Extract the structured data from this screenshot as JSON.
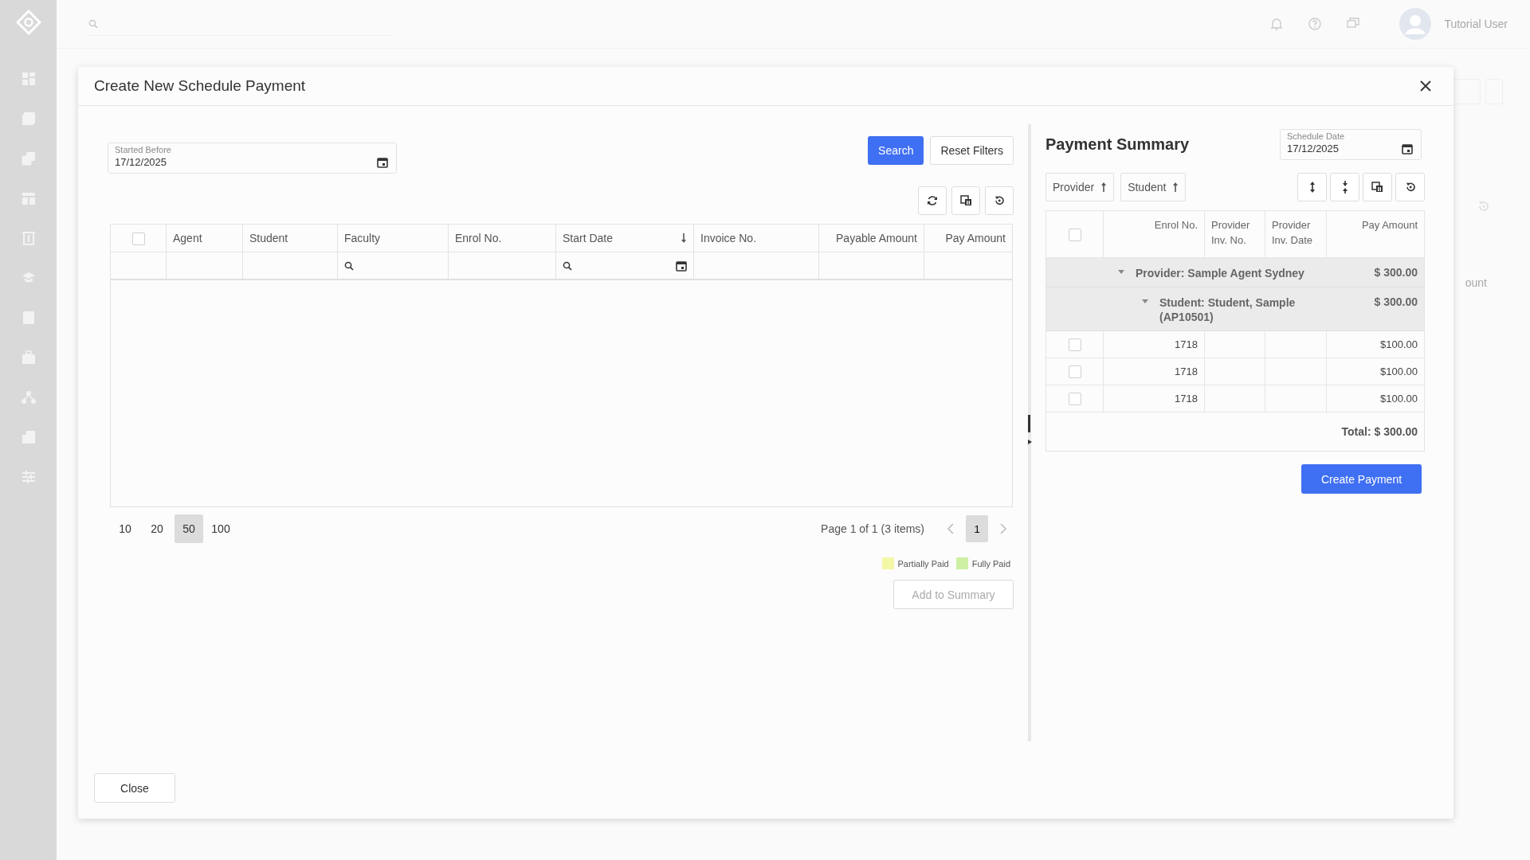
{
  "top_bar": {
    "user_name": "Tutorial User"
  },
  "background": {
    "fragment": "ount"
  },
  "dialog": {
    "title": "Create New Schedule Payment",
    "started_before": {
      "label": "Started Before",
      "value": "17/12/2025"
    },
    "search_button": "Search",
    "reset_button": "Reset Filters",
    "table": {
      "select_all": {
        "checked": false
      },
      "columns": [
        {
          "label": "Agent",
          "right_aligned": false,
          "search_filter": false,
          "date_filter": false,
          "sorted_descending": false
        },
        {
          "label": "Student",
          "right_aligned": false,
          "search_filter": false,
          "date_filter": false,
          "sorted_descending": false
        },
        {
          "label": "Faculty",
          "right_aligned": false,
          "search_filter": true,
          "date_filter": false,
          "sorted_descending": false
        },
        {
          "label": "Enrol No.",
          "right_aligned": false,
          "search_filter": false,
          "date_filter": false,
          "sorted_descending": false
        },
        {
          "label": "Start Date",
          "right_aligned": false,
          "search_filter": true,
          "date_filter": true,
          "sorted_descending": true
        },
        {
          "label": "Invoice No.",
          "right_aligned": false,
          "search_filter": false,
          "date_filter": false,
          "sorted_descending": false
        },
        {
          "label": "Payable Amount",
          "right_aligned": true,
          "search_filter": false,
          "date_filter": false,
          "sorted_descending": false
        },
        {
          "label": "Pay Amount",
          "right_aligned": true,
          "search_filter": false,
          "date_filter": false,
          "sorted_descending": false
        }
      ]
    },
    "pager": {
      "page_sizes": [
        {
          "label": "10",
          "selected": false
        },
        {
          "label": "20",
          "selected": false
        },
        {
          "label": "50",
          "selected": true
        },
        {
          "label": "100",
          "selected": false
        }
      ],
      "info": "Page 1 of 1 (3 items)",
      "pages": [
        {
          "label": "1",
          "selected": true
        }
      ]
    },
    "legend": [
      {
        "label": "Partially Paid",
        "color": "#f4f7a6"
      },
      {
        "label": "Fully Paid",
        "color": "#cdf0a4"
      }
    ],
    "add_button": {
      "label": "Add to Summary",
      "disabled": true
    },
    "close_button": "Close"
  },
  "summary": {
    "title": "Payment Summary",
    "schedule_date": {
      "label": "Schedule Date",
      "value": "17/12/2025"
    },
    "group_chips": [
      {
        "label": "Provider",
        "sorted_ascending": true
      },
      {
        "label": "Student",
        "sorted_ascending": true
      }
    ],
    "select_all": {
      "checked": false
    },
    "columns": [
      {
        "label": "Enrol No.",
        "right_aligned": true
      },
      {
        "label": "Provider Inv. No.",
        "right_aligned": false
      },
      {
        "label": "Provider Inv. Date",
        "right_aligned": false
      },
      {
        "label": "Pay Amount",
        "right_aligned": true
      }
    ],
    "groups": [
      {
        "label": "Provider: Sample Agent Sydney",
        "amount": "$ 300.00",
        "expanded": true,
        "children": [
          {
            "label": "Student: Student, Sample (AP10501)",
            "amount": "$ 300.00",
            "expanded": true,
            "rows": [
              {
                "checked": false,
                "enrol_no": "1718",
                "pay_amount": "$100.00"
              },
              {
                "checked": false,
                "enrol_no": "1718",
                "pay_amount": "$100.00"
              },
              {
                "checked": false,
                "enrol_no": "1718",
                "pay_amount": "$100.00"
              }
            ]
          }
        ]
      }
    ],
    "total": "Total: $ 300.00",
    "create_button": "Create Payment"
  }
}
